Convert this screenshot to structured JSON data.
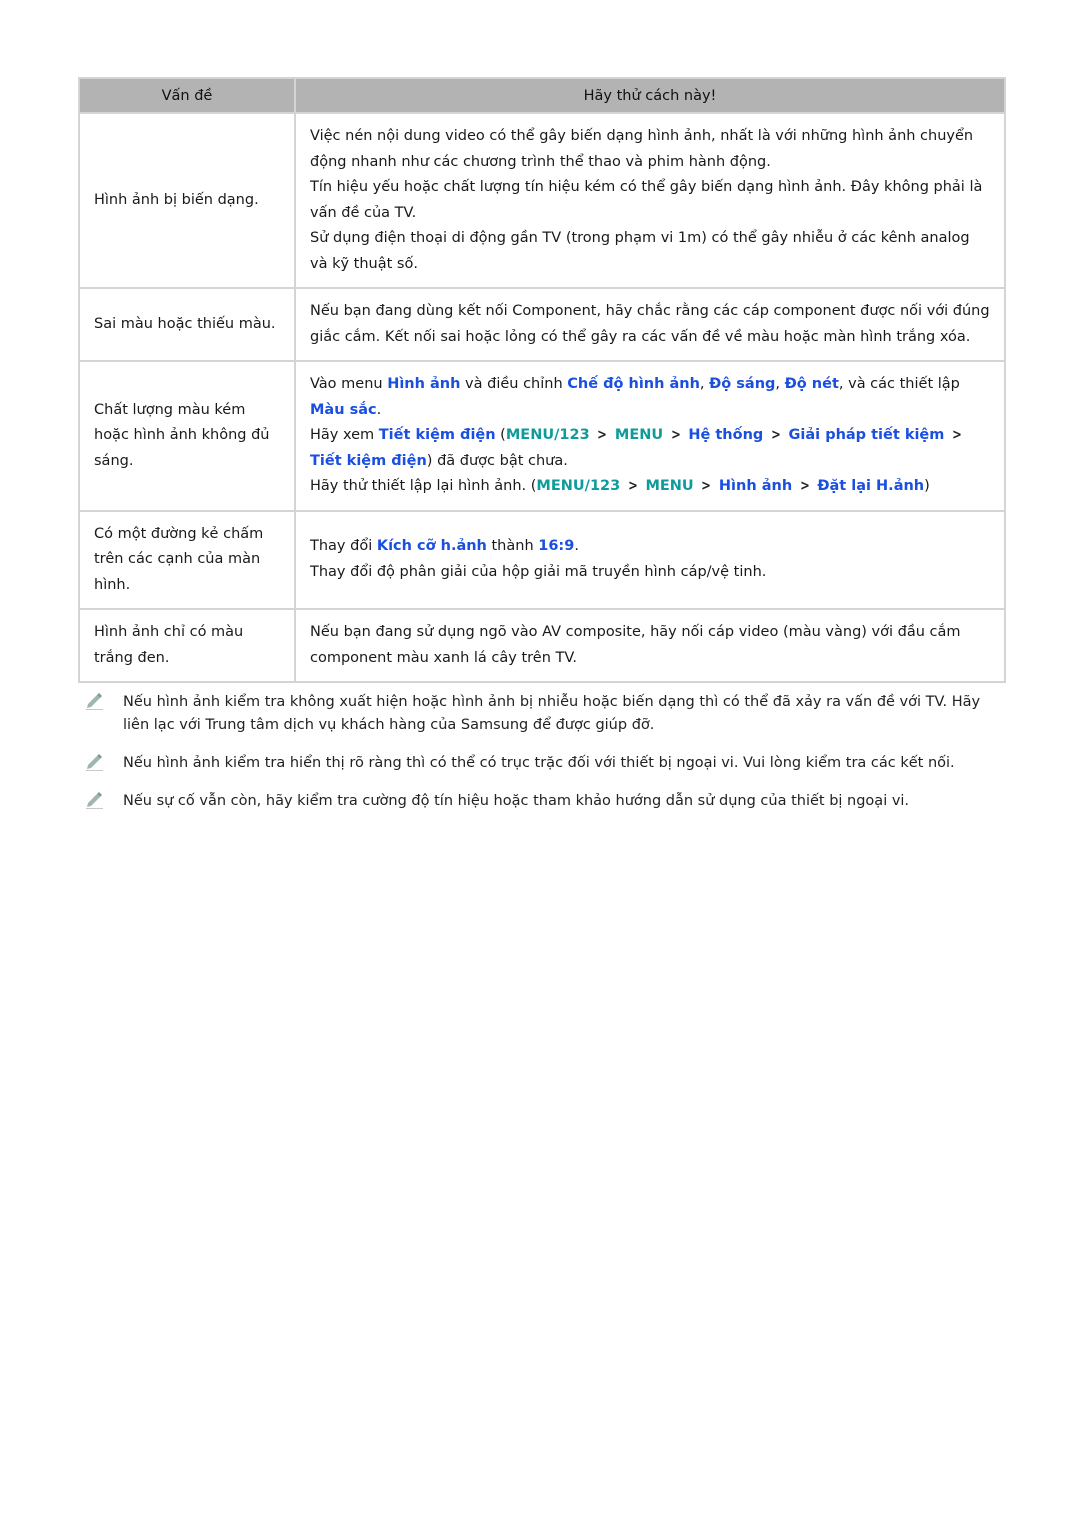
{
  "table": {
    "headers": [
      "Vấn đề",
      "Hãy thử cách này!"
    ],
    "rows": [
      {
        "problem": "Hình ảnh bị biến dạng.",
        "solutions": [
          "Việc nén nội dung video có thể gây biến dạng hình ảnh, nhất là với những hình ảnh chuyển động nhanh như các chương trình thể thao và phim hành động.",
          "Tín hiệu yếu hoặc chất lượng tín hiệu kém có thể gây biến dạng hình ảnh. Đây không phải là vấn đề của TV.",
          "Sử dụng điện thoại di động gần TV (trong phạm vi 1m) có thể gây nhiễu ở các kênh analog và kỹ thuật số."
        ]
      },
      {
        "problem": "Sai màu hoặc thiếu màu.",
        "solutions": [
          "Nếu bạn đang dùng kết nối Component, hãy chắc rằng các cáp component được nối với đúng giắc cắm. Kết nối sai hoặc lỏng có thể gây ra các vấn đề về màu hoặc màn hình trắng xóa."
        ]
      },
      {
        "problem": "Chất lượng màu kém hoặc hình ảnh không đủ sáng.",
        "s1": {
          "pre": "Vào menu ",
          "l1": "Hình ảnh",
          "mid1": " và điều chỉnh ",
          "l2": "Chế độ hình ảnh",
          "sep1": ", ",
          "l3": "Độ sáng",
          "sep2": ", ",
          "l4": "Độ nét",
          "mid2": ", và các thiết lập ",
          "l5": "Màu sắc",
          "end": "."
        },
        "s2": {
          "pre": "Hãy xem ",
          "l1": "Tiết kiệm điện",
          "open": " (",
          "m1": "MENU/123",
          "m2": "MENU",
          "p1": "Hệ thống",
          "p2": "Giải pháp tiết kiệm",
          "p3": "Tiết kiệm điện",
          "end": ") đã được bật chưa."
        },
        "s3": {
          "pre": "Hãy thử thiết lập lại hình ảnh. (",
          "m1": "MENU/123",
          "m2": "MENU",
          "p1": "Hình ảnh",
          "p2": "Đặt lại H.ảnh",
          "end": ")"
        }
      },
      {
        "problem": "Có một đường kẻ chấm trên các cạnh của màn hình.",
        "s1": {
          "pre": "Thay đổi ",
          "l1": "Kích cỡ h.ảnh",
          "mid": " thành ",
          "l2": "16:9",
          "end": "."
        },
        "s2": "Thay đổi độ phân giải của hộp giải mã truyền hình cáp/vệ tinh."
      },
      {
        "problem": "Hình ảnh chỉ có màu trắng đen.",
        "solutions": [
          "Nếu bạn đang sử dụng ngõ vào AV composite, hãy nối cáp video (màu vàng) với đầu cắm component màu xanh lá cây trên TV."
        ]
      }
    ]
  },
  "notes": [
    {
      "icon": "pencil-note-icon",
      "text": "Nếu hình ảnh kiểm tra không xuất hiện hoặc hình ảnh bị nhiễu hoặc biến dạng thì có thể đã xảy ra vấn đề với TV. Hãy liên lạc với Trung tâm dịch vụ khách hàng của Samsung để được giúp đỡ."
    },
    {
      "icon": "pencil-note-icon",
      "text": "Nếu hình ảnh kiểm tra hiển thị rõ ràng thì có thể có trục trặc đối với thiết bị ngoại vi. Vui lòng kiểm tra các kết nối."
    },
    {
      "icon": "pencil-note-icon",
      "text": "Nếu sự cố vẫn còn, hãy kiểm tra cường độ tín hiệu hoặc tham khảo hướng dẫn sử dụng của thiết bị ngoại vi."
    }
  ],
  "colors": {
    "header_bg": "#b3b3b3",
    "link_blue": "#1a4fe0",
    "menu_teal": "#0f9b9b",
    "border": "#d4d4d4"
  }
}
